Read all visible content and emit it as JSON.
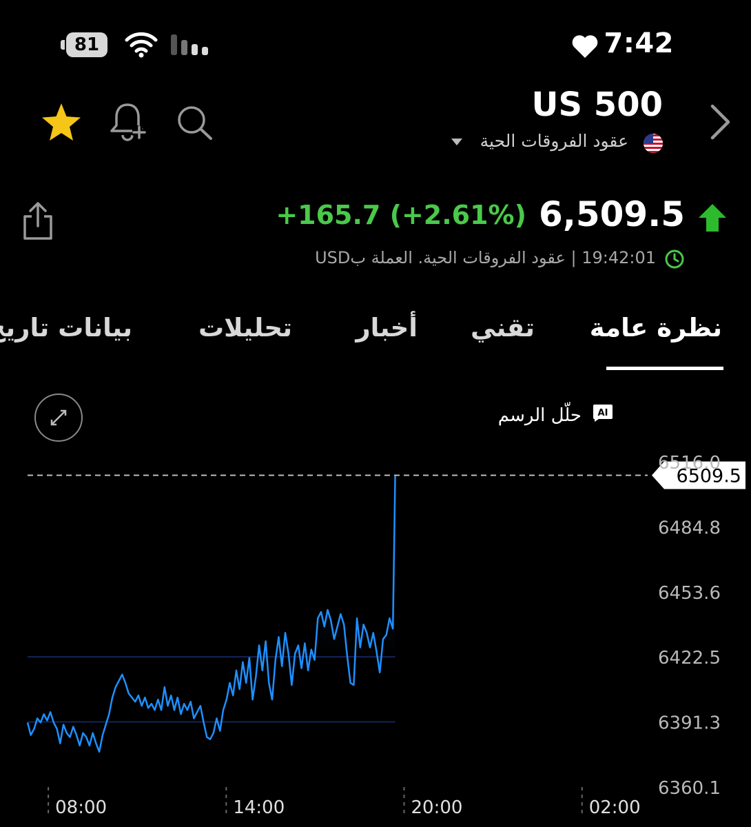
{
  "status": {
    "battery": "81",
    "time": "7:42"
  },
  "header": {
    "title": "US 500",
    "subtitle": "عقود الفروقات الحية",
    "price": "6,509.5",
    "change": "+165.7 (+2.61%)",
    "timestamp": "19:42:01",
    "meta": "| عقود الفروقات الحية. العملة بUSD"
  },
  "tabs": [
    "نظرة عامة",
    "تقني",
    "أخبار",
    "تحليلات",
    "بيانات تاريخ"
  ],
  "ai_label": "حلّل الرسم",
  "ai_badge": "AI",
  "colors": {
    "up": "#4ac94a",
    "line": "#1e90ff",
    "star": "#f5c518"
  },
  "chart_data": {
    "type": "line",
    "current_price": "6509.5",
    "ylim": [
      6360.1,
      6516.0
    ],
    "y_ticks": [
      "6516.0",
      "6484.8",
      "6453.6",
      "6422.5",
      "6391.3",
      "6360.1"
    ],
    "x_ticks": [
      "08:00",
      "14:00",
      "20:00",
      "02:00"
    ],
    "x_range_hours": [
      7.3,
      31.7
    ],
    "series": [
      {
        "x": [
          7.3,
          7.41,
          7.52,
          7.63,
          7.74,
          7.85,
          7.96,
          8.07,
          8.18,
          8.29,
          8.4,
          8.51,
          8.62,
          8.73,
          8.84,
          8.95,
          9.06,
          9.17,
          9.28,
          9.39,
          9.5,
          9.61,
          9.72,
          9.83,
          9.94,
          10.05,
          10.16,
          10.27,
          10.38,
          10.49,
          10.6,
          10.71,
          10.82,
          10.93,
          11.04,
          11.15,
          11.26,
          11.37,
          11.48,
          11.59,
          11.7,
          11.81,
          11.92,
          12.03,
          12.14,
          12.25,
          12.36,
          12.47,
          12.58,
          12.69,
          12.8,
          12.91,
          13.02,
          13.13,
          13.24,
          13.35,
          13.46,
          13.57,
          13.68,
          13.79,
          13.9,
          14.01,
          14.12,
          14.23,
          14.34,
          14.45,
          14.56,
          14.67,
          14.78,
          14.89,
          15.0,
          15.11,
          15.22,
          15.33,
          15.44,
          15.55,
          15.66,
          15.77,
          15.88,
          15.99,
          16.1,
          16.21,
          16.32,
          16.43,
          16.54,
          16.65,
          16.76,
          16.87,
          16.98,
          17.09,
          17.2,
          17.31,
          17.42,
          17.53,
          17.64,
          17.75,
          17.86,
          17.97,
          18.08,
          18.19,
          18.3,
          18.41,
          18.52,
          18.63,
          18.74,
          18.85,
          18.96,
          19.07,
          19.18,
          19.29,
          19.4,
          19.51,
          19.62,
          19.7
        ],
        "y": [
          6391,
          6385,
          6388,
          6393,
          6391,
          6395,
          6392,
          6396,
          6391,
          6388,
          6381,
          6390,
          6386,
          6384,
          6389,
          6385,
          6380,
          6386,
          6384,
          6380,
          6386,
          6381,
          6377,
          6385,
          6390,
          6395,
          6403,
          6408,
          6411,
          6414,
          6410,
          6405,
          6403,
          6401,
          6404,
          6399,
          6403,
          6398,
          6400,
          6397,
          6402,
          6397,
          6408,
          6399,
          6404,
          6397,
          6403,
          6395,
          6400,
          6397,
          6401,
          6393,
          6396,
          6399,
          6391,
          6384,
          6383,
          6386,
          6393,
          6387,
          6397,
          6402,
          6410,
          6404,
          6416,
          6407,
          6420,
          6410,
          6422,
          6402,
          6413,
          6428,
          6416,
          6430,
          6410,
          6402,
          6421,
          6432,
          6418,
          6434,
          6424,
          6409,
          6424,
          6428,
          6417,
          6429,
          6416,
          6426,
          6421,
          6441,
          6444,
          6437,
          6445,
          6440,
          6431,
          6437,
          6443,
          6438,
          6423,
          6410,
          6409,
          6441,
          6427,
          6438,
          6434,
          6427,
          6434,
          6425,
          6415,
          6431,
          6433,
          6441,
          6436,
          6509.5
        ]
      }
    ],
    "reference_lines": [
      6391.3,
      6422.5
    ]
  }
}
